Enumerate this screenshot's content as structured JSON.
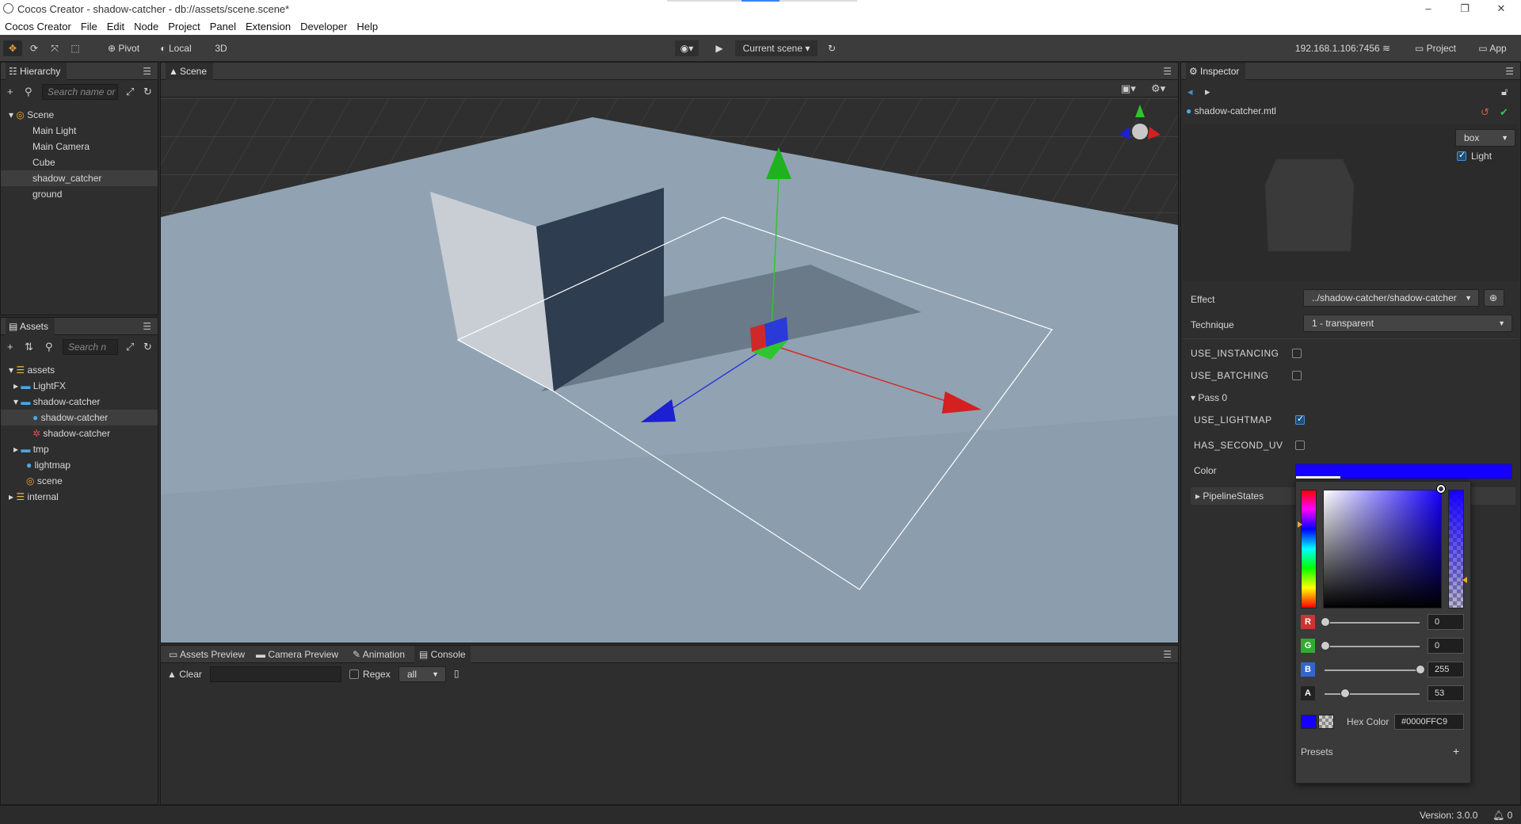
{
  "window": {
    "title": "Cocos Creator - shadow-catcher - db://assets/scene.scene*",
    "minimize": "–",
    "maximize": "❐",
    "close": "✕"
  },
  "menu": [
    "Cocos Creator",
    "File",
    "Edit",
    "Node",
    "Project",
    "Panel",
    "Extension",
    "Developer",
    "Help"
  ],
  "toolbar": {
    "pivot": "Pivot",
    "local": "Local",
    "mode3d": "3D",
    "scene_select": "Current scene",
    "ip": "192.168.1.106:7456",
    "project": "Project",
    "app": "App"
  },
  "hierarchy": {
    "tab": "Hierarchy",
    "search_placeholder": "Search name or",
    "items": [
      {
        "label": "Scene",
        "root": true
      },
      {
        "label": "Main Light"
      },
      {
        "label": "Main Camera"
      },
      {
        "label": "Cube"
      },
      {
        "label": "shadow_catcher",
        "selected": true
      },
      {
        "label": "ground"
      }
    ]
  },
  "assets": {
    "tab": "Assets",
    "search_placeholder": "Search n",
    "items": [
      {
        "label": "assets"
      },
      {
        "label": "LightFX"
      },
      {
        "label": "shadow-catcher"
      },
      {
        "label": "shadow-catcher",
        "selected": true
      },
      {
        "label": "shadow-catcher"
      },
      {
        "label": "tmp"
      },
      {
        "label": "lightmap"
      },
      {
        "label": "scene"
      },
      {
        "label": "internal"
      }
    ]
  },
  "scene": {
    "tab": "Scene"
  },
  "bottom": {
    "tabs": [
      "Assets Preview",
      "Camera Preview",
      "Animation",
      "Console"
    ],
    "clear": "Clear",
    "regex": "Regex",
    "filter": "all"
  },
  "inspector": {
    "tab": "Inspector",
    "file": "shadow-catcher.mtl",
    "preview_shape": "box",
    "light_label": "Light",
    "effect_label": "Effect",
    "effect_value": "../shadow-catcher/shadow-catcher",
    "technique_label": "Technique",
    "technique_value": "1 - transparent",
    "use_instancing": "USE_INSTANCING",
    "use_batching": "USE_BATCHING",
    "pass": "Pass 0",
    "use_lightmap": "USE_LIGHTMAP",
    "has_second_uv": "HAS_SECOND_UV",
    "color_label": "Color",
    "pipeline_states": "PipelineStates",
    "color_hex": "#0000FF"
  },
  "color_picker": {
    "channels": [
      {
        "name": "R",
        "value": "0",
        "color": "#c33"
      },
      {
        "name": "G",
        "value": "0",
        "color": "#3a3"
      },
      {
        "name": "B",
        "value": "255",
        "color": "#36c"
      },
      {
        "name": "A",
        "value": "53",
        "color": "#222"
      }
    ],
    "hex_label": "Hex Color",
    "hex_value": "#0000FFC9",
    "presets": "Presets",
    "add": "+"
  },
  "status": {
    "version": "Version: 3.0.0",
    "notifications": "0"
  }
}
